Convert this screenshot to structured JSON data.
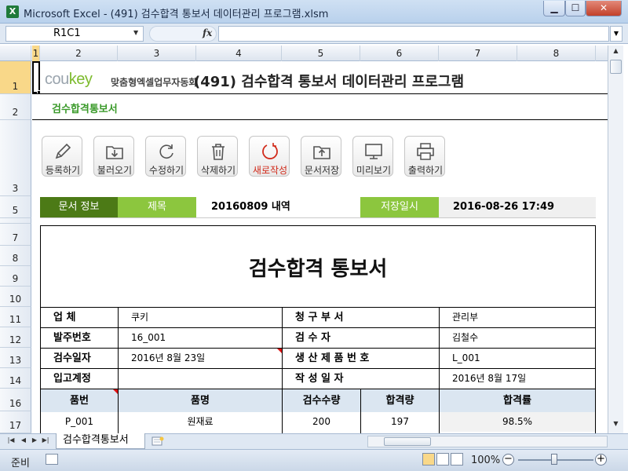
{
  "window": {
    "title": "Microsoft Excel - (491) 검수합격 통보서 데이터관리 프로그램.xlsm",
    "app_icon": "excel-icon",
    "minimize": "▁",
    "maximize": "☐",
    "close": "✕"
  },
  "formula_bar": {
    "name_box": "R1C1",
    "fx_label": "fx",
    "formula": ""
  },
  "columns": [
    "1",
    "2",
    "3",
    "4",
    "5",
    "6",
    "7",
    "8"
  ],
  "rows": [
    "1",
    "2",
    "3",
    "5",
    "7",
    "8",
    "9",
    "10",
    "11",
    "12",
    "13",
    "14",
    "16",
    "17"
  ],
  "header": {
    "logo_brand_a": "cou",
    "logo_brand_b": "key",
    "logo_sub": "맞춤형엑셀업무자동화",
    "title": "(491) 검수합격 통보서 데이터관리 프로그램",
    "subtitle": "검수합격통보서"
  },
  "toolbar": [
    {
      "label": "등록하기",
      "icon": "pencil-icon"
    },
    {
      "label": "불러오기",
      "icon": "folder-download-icon"
    },
    {
      "label": "수정하기",
      "icon": "refresh-icon"
    },
    {
      "label": "삭제하기",
      "icon": "trash-icon"
    },
    {
      "label": "새로작성",
      "icon": "new-circle-icon"
    },
    {
      "label": "문서저장",
      "icon": "folder-upload-icon"
    },
    {
      "label": "미리보기",
      "icon": "monitor-icon"
    },
    {
      "label": "출력하기",
      "icon": "printer-icon"
    }
  ],
  "doc_info": {
    "label": "문서 정보",
    "title_label": "제목",
    "title_value": "20160809 내역",
    "saved_label": "저장일시",
    "saved_value": "2016-08-26 17:49"
  },
  "report": {
    "title": "검수합격 통보서",
    "fields": {
      "vendor_label": "업    체",
      "vendor_value": "쿠키",
      "dept_label": "청  구  부  서",
      "dept_value": "관리부",
      "order_no_label": "발주번호",
      "order_no_value": "16_001",
      "inspector_label": "검      수      자",
      "inspector_value": "김철수",
      "inspect_date_label": "검수일자",
      "inspect_date_value": "2016년 8월 23일",
      "lot_label": "생 산 제 품 번 호",
      "lot_value": "L_001",
      "account_label": "입고계정",
      "account_value": "",
      "created_label": "작    성    일    자",
      "created_value": "2016년 8월 17일"
    },
    "table": {
      "headers": [
        "품번",
        "품명",
        "검수수량",
        "합격량",
        "합격률"
      ],
      "rows": [
        [
          "P_001",
          "원재료",
          "200",
          "197",
          "98.5%"
        ]
      ]
    }
  },
  "sheet_tabs": {
    "active": "검수합격통보서"
  },
  "status": {
    "ready": "준비",
    "zoom": "100%",
    "zoom_minus": "−",
    "zoom_plus": "+"
  }
}
